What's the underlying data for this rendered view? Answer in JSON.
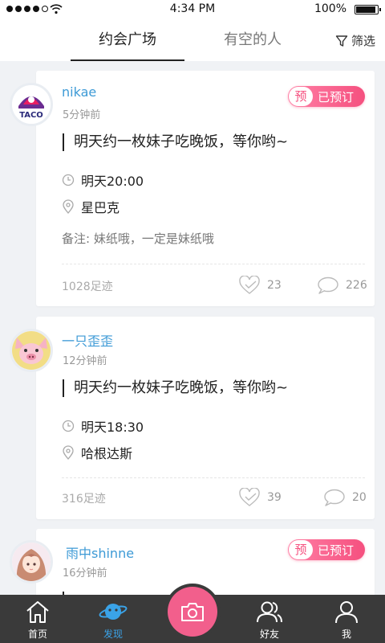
{
  "status_bar": {
    "time": "4:34 PM",
    "battery": "100%"
  },
  "header": {
    "tabs": [
      {
        "label": "约会广场",
        "active": true
      },
      {
        "label": "有空的人",
        "active": false
      }
    ],
    "filter_label": "筛选"
  },
  "posts": [
    {
      "username": "nikae",
      "time_ago": "5分钟前",
      "badge": {
        "icon_text": "预",
        "label": "已预订"
      },
      "title": "明天约一枚妹子吃晚饭，等你哟~",
      "datetime": "明天20:00",
      "location": "星巴克",
      "note": "备注: 妹纸哦，一定是妹纸哦",
      "footprints": "1028足迹",
      "likes": "23",
      "comments": "226",
      "avatar": "taco-bell-logo"
    },
    {
      "username": "一只歪歪",
      "time_ago": "12分钟前",
      "title": "明天约一枚妹子吃晚饭，等你哟~",
      "datetime": "明天18:30",
      "location": "哈根达斯",
      "footprints": "316足迹",
      "likes": "39",
      "comments": "20",
      "avatar": "cartoon-pig"
    },
    {
      "username": "雨中shinne",
      "time_ago": "16分钟前",
      "badge": {
        "icon_text": "预",
        "label": "已预订"
      },
      "avatar": "anime-girl"
    }
  ],
  "bottom_nav": [
    {
      "label": "首页",
      "icon": "home-icon",
      "active": false
    },
    {
      "label": "发现",
      "icon": "planet-icon",
      "active": true
    },
    {
      "label": "好友",
      "icon": "friends-icon",
      "active": false
    },
    {
      "label": "我",
      "icon": "user-icon",
      "active": false
    }
  ],
  "camera_button": {
    "icon": "camera-icon"
  },
  "colors": {
    "accent_pink": "#f5507f",
    "link_blue": "#3d9ad6",
    "nav_bg": "#3a3a3a",
    "nav_active": "#3aa3e8"
  }
}
